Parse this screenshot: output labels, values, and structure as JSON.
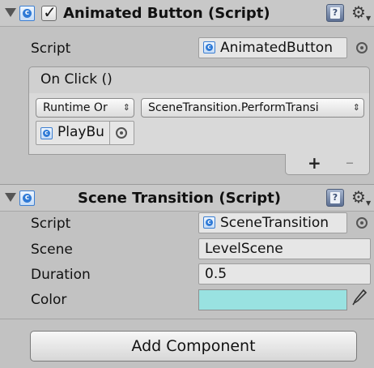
{
  "animated_button": {
    "title": "Animated Button (Script)",
    "enabled": true,
    "script_label": "Script",
    "script_value": "AnimatedButton",
    "on_click": {
      "title": "On Click ()",
      "runtime_dropdown": "Runtime Or",
      "function_dropdown": "SceneTransition.PerformTransi",
      "object_value": "PlayBu",
      "add_symbol": "+",
      "remove_symbol": "–"
    }
  },
  "scene_transition": {
    "title": "Scene Transition (Script)",
    "fields": [
      {
        "label": "Script",
        "value": "SceneTransition"
      },
      {
        "label": "Scene",
        "value": "LevelScene"
      },
      {
        "label": "Duration",
        "value": "0.5"
      },
      {
        "label": "Color",
        "color": "#99e2e1"
      }
    ]
  },
  "add_component": {
    "label": "Add Component"
  },
  "icons": {
    "foldout": "foldout-arrow-icon",
    "script": "script-icon",
    "help": "help-book-icon",
    "settings": "gear-icon",
    "object_picker": "object-picker-icon",
    "eyedropper": "eyedropper-icon"
  }
}
